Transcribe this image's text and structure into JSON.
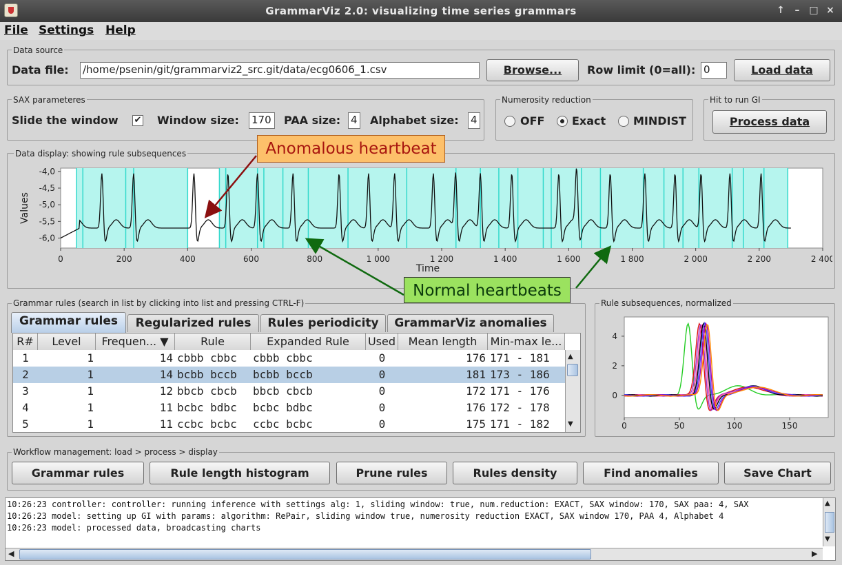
{
  "window": {
    "title": "GrammarViz 2.0: visualizing time series grammars"
  },
  "menu": [
    "File",
    "Settings",
    "Help"
  ],
  "data_source": {
    "group_label": "Data source",
    "file_label": "Data file:",
    "file_value": "/home/psenin/git/grammarviz2_src.git/data/ecg0606_1.csv",
    "browse_label": "Browse...",
    "row_limit_label": "Row limit (0=all):",
    "row_limit_value": "0",
    "load_label": "Load data"
  },
  "sax": {
    "group_label": "SAX parameteres",
    "slide_label": "Slide the window",
    "slide_checked": true,
    "window_label": "Window size:",
    "window_value": "170",
    "paa_label": "PAA size:",
    "paa_value": "4",
    "alphabet_label": "Alphabet size:",
    "alphabet_value": "4"
  },
  "numerosity": {
    "group_label": "Numerosity reduction",
    "options": [
      "OFF",
      "Exact",
      "MINDIST"
    ],
    "selected": "Exact"
  },
  "run_gi": {
    "group_label": "Hit to run GI",
    "process_label": "Process data"
  },
  "data_display": {
    "group_label": "Data display: showing rule subsequences",
    "callout_anomaly": "Anomalous heartbeat",
    "callout_normal": "Normal heartbeats"
  },
  "chart_data": [
    {
      "type": "line",
      "title": "",
      "xlabel": "Time",
      "ylabel": "Values",
      "xlim": [
        0,
        2400
      ],
      "ylim": [
        -6.3,
        -3.9
      ],
      "x_ticks": [
        "0",
        "200",
        "400",
        "600",
        "800",
        "1 000",
        "1 200",
        "1 400",
        "1 600",
        "1 800",
        "2 000",
        "2 200",
        "2 400"
      ],
      "y_ticks": [
        "-4,0",
        "-4,5",
        "-5,0",
        "-5,5",
        "-6,0"
      ],
      "series": [
        {
          "baseline": -5.7,
          "beat_peaks_x": [
            10,
            130,
            230,
            420,
            527,
            620,
            732,
            877,
            970,
            1052,
            1174,
            1244,
            1322,
            1421,
            1569,
            1625,
            1731,
            1840,
            1935,
            2017,
            2108,
            2206
          ],
          "peak_value": -4.0,
          "x_end": 2300
        }
      ],
      "highlight_spans": [
        [
          50,
          400
        ],
        [
          500,
          2290
        ]
      ],
      "highlight_color": "#b6f5ee",
      "highlight_edge_color": "#33d9cc",
      "line_color": "#111111"
    },
    {
      "type": "line",
      "title": "Rule subsequences, normalized",
      "xlim": [
        0,
        185
      ],
      "ylim": [
        -1.5,
        5.3
      ],
      "x_ticks": [
        "0",
        "50",
        "100",
        "150"
      ],
      "y_ticks": [
        "4",
        "2",
        "0"
      ],
      "series_colors": [
        "#22cc22",
        "#e01010",
        "#9933cc",
        "#ff44aa",
        "#000000",
        "#4444ff",
        "#aa00aa",
        "#ff8800"
      ],
      "peak_x": 72,
      "peak_value": 5.0,
      "outlier_peak_x": 58,
      "x_end": 180
    }
  ],
  "grammar": {
    "group_label": "Grammar rules (search in list by clicking into list and pressing CTRL-F)",
    "tabs": [
      "Grammar rules",
      "Regularized rules",
      "Rules periodicity",
      "GrammarViz anomalies"
    ],
    "active_tab": "Grammar rules",
    "columns": [
      "R#",
      "Level",
      "Frequen... ▼",
      "Rule",
      "Expanded Rule",
      "Used",
      "Mean length",
      "Min-max le..."
    ],
    "rows": [
      [
        "1",
        "1",
        "14",
        "cbbb cbbc",
        "cbbb cbbc",
        "0",
        "176",
        "171 - 181"
      ],
      [
        "2",
        "1",
        "14",
        "bcbb bccb",
        "bcbb bccb",
        "0",
        "181",
        "173 - 186"
      ],
      [
        "3",
        "1",
        "12",
        "bbcb cbcb",
        "bbcb cbcb",
        "0",
        "172",
        "171 - 176"
      ],
      [
        "4",
        "1",
        "11",
        "bcbc bdbc",
        "bcbc bdbc",
        "0",
        "176",
        "172 - 178"
      ],
      [
        "5",
        "1",
        "11",
        "ccbc bcbc",
        "ccbc bcbc",
        "0",
        "175",
        "171 - 182"
      ]
    ],
    "selected_row": 1
  },
  "rule_subseq": {
    "group_label": "Rule subsequences, normalized"
  },
  "workflow": {
    "group_label": "Workflow management: load > process > display",
    "buttons": [
      "Grammar rules",
      "Rule length histogram",
      "Prune rules",
      "Rules density",
      "Find anomalies",
      "Save Chart"
    ]
  },
  "log": [
    "10:26:23 controller: controller: running inference with settings alg: 1, sliding window: true, num.reduction: EXACT, SAX window: 170, SAX paa: 4, SAX",
    "10:26:23 model: setting up GI with params: algorithm: RePair, sliding window true, numerosity reduction EXACT, SAX window 170, PAA 4, Alphabet 4",
    "10:26:23 model: processed data, broadcasting charts"
  ]
}
